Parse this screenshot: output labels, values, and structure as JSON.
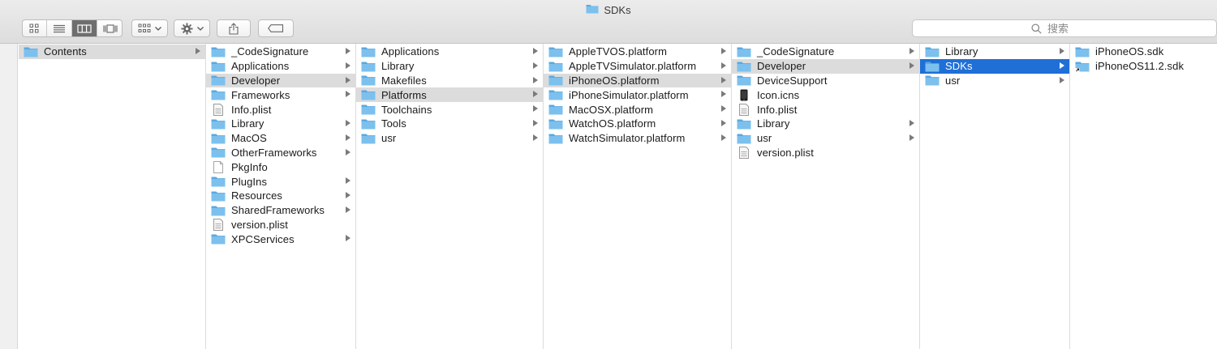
{
  "window": {
    "title": "SDKs"
  },
  "toolbar": {
    "search_placeholder": "搜索"
  },
  "columns": [
    {
      "items": [
        {
          "name": "Contents",
          "type": "folder",
          "arrow": true,
          "selected": "gray"
        }
      ]
    },
    {
      "items": [
        {
          "name": "_CodeSignature",
          "type": "folder",
          "arrow": true
        },
        {
          "name": "Applications",
          "type": "folder",
          "arrow": true
        },
        {
          "name": "Developer",
          "type": "folder",
          "arrow": true,
          "selected": "gray"
        },
        {
          "name": "Frameworks",
          "type": "folder",
          "arrow": true
        },
        {
          "name": "Info.plist",
          "type": "plist",
          "arrow": false
        },
        {
          "name": "Library",
          "type": "folder",
          "arrow": true
        },
        {
          "name": "MacOS",
          "type": "folder",
          "arrow": true
        },
        {
          "name": "OtherFrameworks",
          "type": "folder",
          "arrow": true
        },
        {
          "name": "PkgInfo",
          "type": "doc",
          "arrow": false
        },
        {
          "name": "PlugIns",
          "type": "folder",
          "arrow": true
        },
        {
          "name": "Resources",
          "type": "folder",
          "arrow": true
        },
        {
          "name": "SharedFrameworks",
          "type": "folder",
          "arrow": true
        },
        {
          "name": "version.plist",
          "type": "plist",
          "arrow": false
        },
        {
          "name": "XPCServices",
          "type": "folder",
          "arrow": true
        }
      ]
    },
    {
      "items": [
        {
          "name": "Applications",
          "type": "folder",
          "arrow": true
        },
        {
          "name": "Library",
          "type": "folder",
          "arrow": true
        },
        {
          "name": "Makefiles",
          "type": "folder",
          "arrow": true
        },
        {
          "name": "Platforms",
          "type": "folder",
          "arrow": true,
          "selected": "gray"
        },
        {
          "name": "Toolchains",
          "type": "folder",
          "arrow": true
        },
        {
          "name": "Tools",
          "type": "folder",
          "arrow": true
        },
        {
          "name": "usr",
          "type": "folder",
          "arrow": true
        }
      ]
    },
    {
      "items": [
        {
          "name": "AppleTVOS.platform",
          "type": "folder",
          "arrow": true
        },
        {
          "name": "AppleTVSimulator.platform",
          "type": "folder",
          "arrow": true
        },
        {
          "name": "iPhoneOS.platform",
          "type": "folder",
          "arrow": true,
          "selected": "gray"
        },
        {
          "name": "iPhoneSimulator.platform",
          "type": "folder",
          "arrow": true
        },
        {
          "name": "MacOSX.platform",
          "type": "folder",
          "arrow": true
        },
        {
          "name": "WatchOS.platform",
          "type": "folder",
          "arrow": true
        },
        {
          "name": "WatchSimulator.platform",
          "type": "folder",
          "arrow": true
        }
      ]
    },
    {
      "items": [
        {
          "name": "_CodeSignature",
          "type": "folder",
          "arrow": true
        },
        {
          "name": "Developer",
          "type": "folder",
          "arrow": true,
          "selected": "gray"
        },
        {
          "name": "DeviceSupport",
          "type": "folder",
          "arrow": false
        },
        {
          "name": "Icon.icns",
          "type": "phone",
          "arrow": false
        },
        {
          "name": "Info.plist",
          "type": "plist",
          "arrow": false
        },
        {
          "name": "Library",
          "type": "folder",
          "arrow": true
        },
        {
          "name": "usr",
          "type": "folder",
          "arrow": true
        },
        {
          "name": "version.plist",
          "type": "plist",
          "arrow": false
        }
      ]
    },
    {
      "items": [
        {
          "name": "Library",
          "type": "folder",
          "arrow": true
        },
        {
          "name": "SDKs",
          "type": "folder",
          "arrow": true,
          "selected": "blue"
        },
        {
          "name": "usr",
          "type": "folder",
          "arrow": true
        }
      ]
    },
    {
      "items": [
        {
          "name": "iPhoneOS.sdk",
          "type": "folder",
          "arrow": false
        },
        {
          "name": "iPhoneOS11.2.sdk",
          "type": "alias-folder",
          "arrow": false
        }
      ]
    }
  ],
  "colors": {
    "folder_fill": "#7cc0ee",
    "folder_tab": "#5aa9e0",
    "selection_blue": "#1f6fd6",
    "selection_gray": "#dcdcdc"
  }
}
